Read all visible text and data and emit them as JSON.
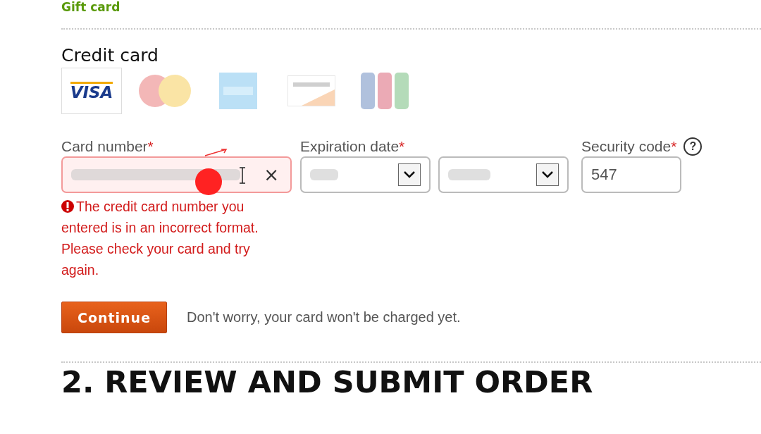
{
  "gift_card_link": "Gift card",
  "credit_card": {
    "title": "Credit card",
    "cards": [
      {
        "kind": "visa",
        "label": "VISA",
        "selected": true
      },
      {
        "kind": "mastercard",
        "selected": false
      },
      {
        "kind": "amex",
        "selected": false
      },
      {
        "kind": "discover",
        "selected": false
      },
      {
        "kind": "jcb",
        "selected": false
      }
    ],
    "fields": [
      {
        "kind": "card_number",
        "label": "Card number",
        "required_mark": "*",
        "invalid": true,
        "clear": "×"
      },
      {
        "kind": "expiration",
        "label": "Expiration date",
        "required_mark": "*"
      },
      {
        "kind": "security_code",
        "label": "Security code",
        "required_mark": "*",
        "value": "547",
        "help": "?"
      }
    ],
    "error": "The credit card number you entered is in an incorrect format. Please check your card and try again."
  },
  "continue_button": "Continue",
  "note": "Don't worry, your card won't be charged yet.",
  "next_section": "2. REVIEW AND SUBMIT ORDER"
}
